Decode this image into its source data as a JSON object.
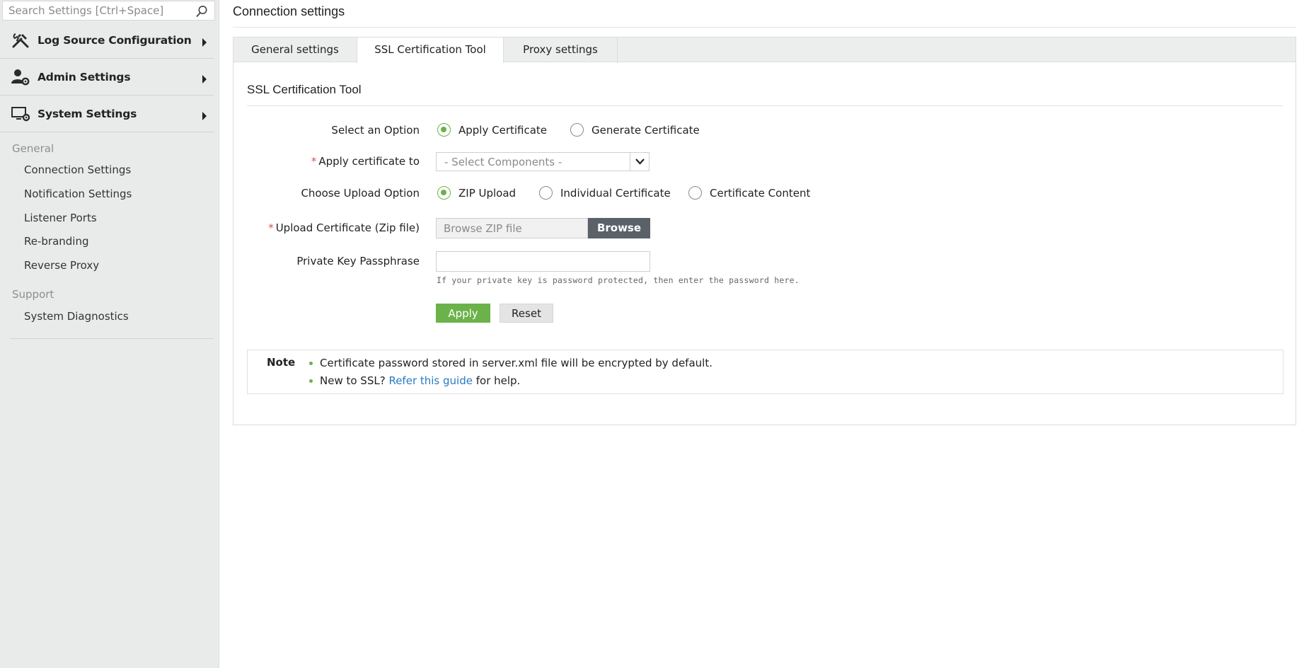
{
  "search": {
    "placeholder": "Search Settings [Ctrl+Space]"
  },
  "sidebar": {
    "menu": [
      {
        "label": "Log Source Configuration",
        "icon": "tools-icon"
      },
      {
        "label": "Admin Settings",
        "icon": "user-gear-icon"
      },
      {
        "label": "System Settings",
        "icon": "monitor-gear-icon"
      }
    ],
    "general_label": "General",
    "general_items": [
      "Connection Settings",
      "Notification Settings",
      "Listener Ports",
      "Re-branding",
      "Reverse Proxy"
    ],
    "support_label": "Support",
    "support_items": [
      "System Diagnostics"
    ]
  },
  "page": {
    "title": "Connection settings"
  },
  "tabs": [
    {
      "label": "General settings",
      "active": false
    },
    {
      "label": "SSL Certification Tool",
      "active": true
    },
    {
      "label": "Proxy settings",
      "active": false
    }
  ],
  "form": {
    "section_title": "SSL Certification Tool",
    "select_option_label": "Select an Option",
    "option_apply": "Apply Certificate",
    "option_generate": "Generate Certificate",
    "apply_to_label": "Apply certificate to",
    "apply_to_value": "- Select Components -",
    "upload_option_label": "Choose Upload Option",
    "upload_zip": "ZIP Upload",
    "upload_individual": "Individual Certificate",
    "upload_content": "Certificate Content",
    "upload_cert_label": "Upload Certificate (Zip file)",
    "file_placeholder": "Browse ZIP file",
    "browse_label": "Browse",
    "passphrase_label": "Private Key Passphrase",
    "passphrase_hint": "If your private key is password protected, then enter the password here.",
    "apply_label": "Apply",
    "reset_label": "Reset",
    "required_mark": "*"
  },
  "note": {
    "title": "Note",
    "line1": "Certificate password stored in server.xml file will be encrypted by default.",
    "line2_prefix": "New to SSL? ",
    "line2_link": "Refer this guide",
    "line2_suffix": " for help."
  },
  "colors": {
    "accent": "#6bb24a",
    "link": "#2a7ac4",
    "browse_button": "#5a6169",
    "required": "#d9534f"
  }
}
